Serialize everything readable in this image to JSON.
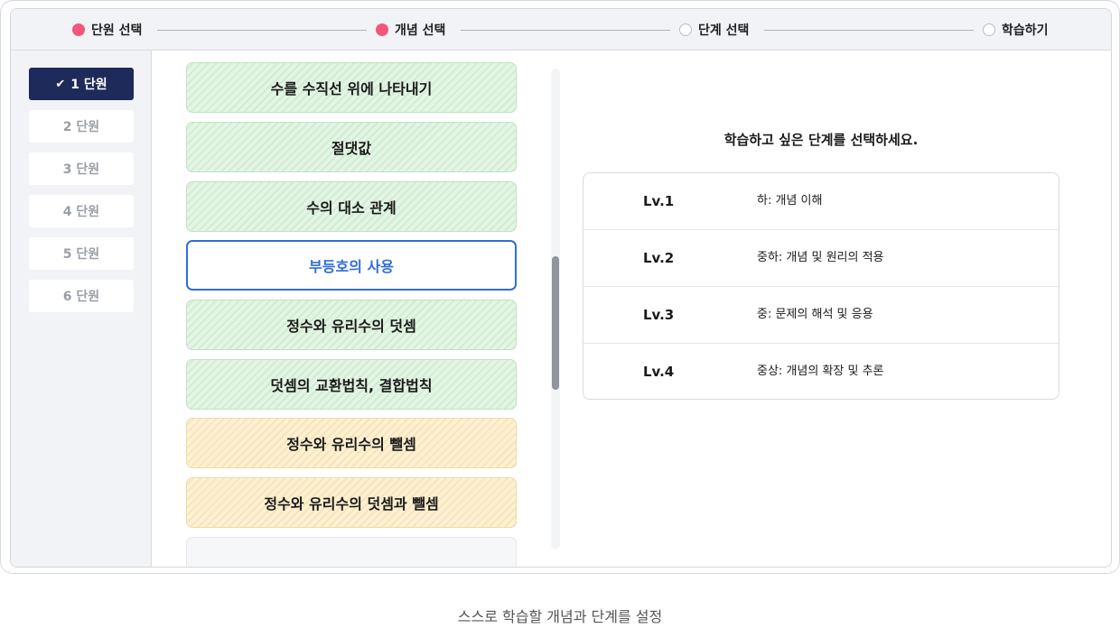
{
  "stepper": {
    "steps": [
      {
        "label": "단원 선택",
        "done": true
      },
      {
        "label": "개념 선택",
        "done": true
      },
      {
        "label": "단계 선택",
        "done": false
      },
      {
        "label": "학습하기",
        "done": false
      }
    ]
  },
  "sidebar": {
    "units": [
      {
        "label": "1 단원",
        "active": true,
        "check": "✔"
      },
      {
        "label": "2 단원",
        "active": false
      },
      {
        "label": "3 단원",
        "active": false
      },
      {
        "label": "4 단원",
        "active": false
      },
      {
        "label": "5 단원",
        "active": false
      },
      {
        "label": "6 단원",
        "active": false
      }
    ]
  },
  "concepts": [
    {
      "label": "수를 수직선 위에 나타내기",
      "color": "green"
    },
    {
      "label": "절댓값",
      "color": "green"
    },
    {
      "label": "수의 대소 관계",
      "color": "green"
    },
    {
      "label": "부등호의 사용",
      "color": "selected"
    },
    {
      "label": "정수와 유리수의 덧셈",
      "color": "green"
    },
    {
      "label": "덧셈의 교환법칙, 결합법칙",
      "color": "green"
    },
    {
      "label": "정수와 유리수의 뺄셈",
      "color": "yellow"
    },
    {
      "label": "정수와 유리수의 덧셈과 뺄셈",
      "color": "yellow"
    }
  ],
  "levels": {
    "title": "학습하고 싶은 단계를 선택하세요.",
    "rows": [
      {
        "name": "Lv.1",
        "desc": "하: 개념 이해"
      },
      {
        "name": "Lv.2",
        "desc": "중하: 개념 및 원리의 적용"
      },
      {
        "name": "Lv.3",
        "desc": "중: 문제의 해석 및 응용"
      },
      {
        "name": "Lv.4",
        "desc": "중상: 개념의 확장 및 추론"
      }
    ]
  },
  "caption": "스스로 학습할 개념과 단계를 설정",
  "colors": {
    "accent_pink": "#f2577a",
    "active_navy": "#1e2a5a",
    "selected_blue": "#2f6ed9",
    "mastered_green": "#e3f5e3",
    "partial_yellow": "#fdf1d5"
  }
}
